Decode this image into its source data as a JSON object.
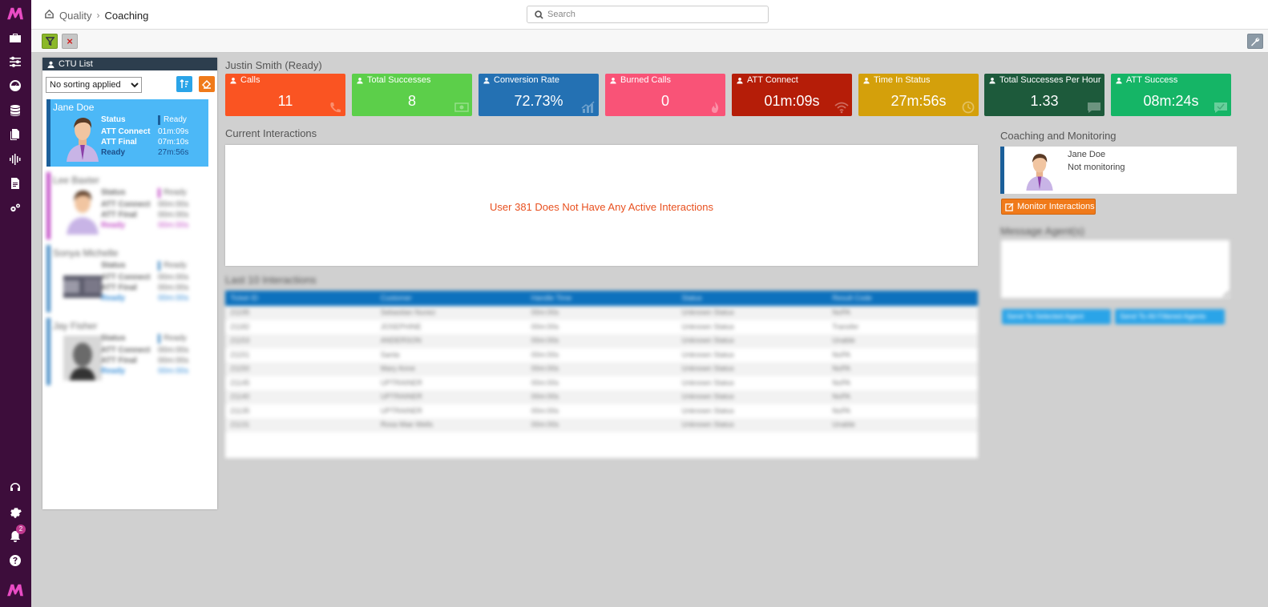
{
  "header": {
    "breadcrumb": [
      "Quality",
      "Coaching"
    ],
    "search_placeholder": "Search"
  },
  "toolbar": {
    "clear_label": "×"
  },
  "ctu_list": {
    "title": "CTU List",
    "sort_selected": "No sorting applied",
    "agents": [
      {
        "name": "Jane Doe",
        "status_label": "Status",
        "status": "Ready",
        "att_connect_label": "ATT Connect",
        "att_connect": "01m:09s",
        "att_final_label": "ATT Final",
        "att_final": "07m:10s",
        "state_label": "Ready",
        "state_time": "27m:56s"
      },
      {
        "name": "Lee Baxter",
        "status_label": "Status",
        "status": "Ready",
        "att_connect_label": "ATT Connect",
        "att_connect": "00m:00s",
        "att_final_label": "ATT Final",
        "att_final": "00m:00s",
        "state_label": "Ready",
        "state_time": "00m:00s"
      },
      {
        "name": "Sonya Michelle",
        "status_label": "Status",
        "status": "Ready",
        "att_connect_label": "ATT Connect",
        "att_connect": "00m:00s",
        "att_final_label": "ATT Final",
        "att_final": "00m:00s",
        "state_label": "Ready",
        "state_time": "00m:00s"
      },
      {
        "name": "Jay Fisher",
        "status_label": "Status",
        "status": "Ready",
        "att_connect_label": "ATT Connect",
        "att_connect": "00m:00s",
        "att_final_label": "ATT Final",
        "att_final": "00m:00s",
        "state_label": "Ready",
        "state_time": "00m:00s"
      }
    ]
  },
  "agent_title": "Justin Smith (Ready)",
  "kpis": [
    {
      "label": "Calls",
      "value": "11",
      "color": "#fa5422",
      "icon": "phone-icon"
    },
    {
      "label": "Total Successes",
      "value": "8",
      "color": "#5ccf4a",
      "icon": "money-icon"
    },
    {
      "label": "Conversion Rate",
      "value": "72.73%",
      "color": "#2471b3",
      "icon": "chart-icon"
    },
    {
      "label": "Burned Calls",
      "value": "0",
      "color": "#f95377",
      "icon": "fire-icon"
    },
    {
      "label": "ATT Connect",
      "value": "01m:09s",
      "color": "#b51d08",
      "icon": "wifi-icon"
    },
    {
      "label": "Time In Status",
      "value": "27m:56s",
      "color": "#d4a00b",
      "icon": "clock-icon"
    },
    {
      "label": "Total Successes Per Hour",
      "value": "1.33",
      "color": "#1d5a3b",
      "icon": "chat-icon"
    },
    {
      "label": "ATT Success",
      "value": "08m:24s",
      "color": "#15b566",
      "icon": "check-chat-icon"
    }
  ],
  "current_interactions": {
    "title": "Current Interactions",
    "empty_message": "User 381 Does Not Have Any Active Interactions"
  },
  "last_interactions": {
    "title": "Last 10 Interactions",
    "columns": [
      "Ticket ID",
      "Customer",
      "Handle Time",
      "Status",
      "Result Code"
    ],
    "rows": [
      [
        "21195",
        "Sebastian Nunez",
        "00m:00s",
        "Unknown Status",
        "NoPA"
      ],
      [
        "21182",
        "JOSEPHINE",
        "00m:00s",
        "Unknown Status",
        "Transfer"
      ],
      [
        "21153",
        "ANDERSON",
        "00m:00s",
        "Unknown Status",
        "Unable"
      ],
      [
        "21151",
        "Santa",
        "00m:00s",
        "Unknown Status",
        "NoPA"
      ],
      [
        "21150",
        "Mary Anne",
        "00m:00s",
        "Unknown Status",
        "NoPA"
      ],
      [
        "21145",
        "UPTRAINER",
        "00m:00s",
        "Unknown Status",
        "NoPA"
      ],
      [
        "21140",
        "UPTRAINER",
        "00m:00s",
        "Unknown Status",
        "NoPA"
      ],
      [
        "21135",
        "UPTRAINER",
        "00m:00s",
        "Unknown Status",
        "NoPA"
      ],
      [
        "21131",
        "Rosa Mae Wells",
        "00m:00s",
        "Unknown Status",
        "Unable"
      ]
    ]
  },
  "coaching": {
    "title": "Coaching and Monitoring",
    "agent_name": "Jane Doe",
    "monitor_status": "Not monitoring",
    "monitor_button": "Monitor Interactions",
    "message_title": "Message Agent(s)",
    "send_selected": "Send To Selected Agent",
    "send_all": "Send To All Filtered Agents"
  },
  "rail": {
    "notification_count": "2"
  },
  "colors": {
    "rail": "#3d0d3b",
    "accent_blue": "#4cb8f7",
    "accent_orange": "#f07a1a",
    "alert_text": "#e8501f"
  }
}
